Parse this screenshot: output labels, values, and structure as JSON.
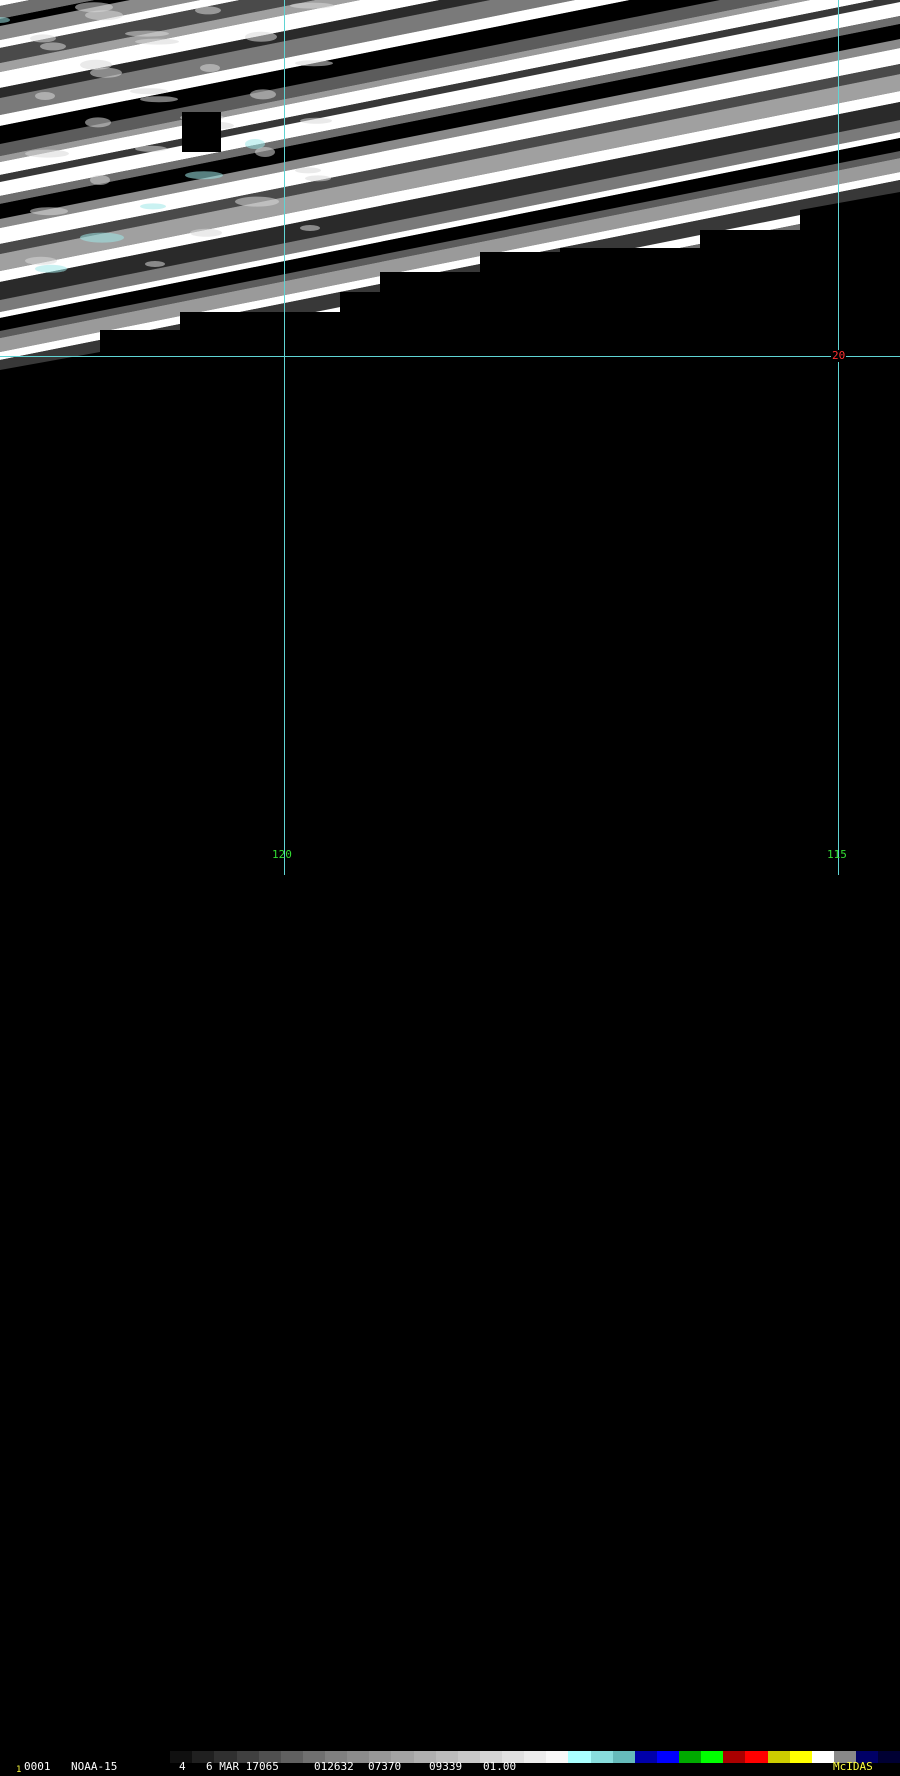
{
  "image_panel": {
    "description_icon": "satellite-imagery"
  },
  "grid": {
    "line_color": "#5fd4d4",
    "lon_label_color": "#33dd33",
    "lat_label_color": "#ff3030",
    "lon_labels": [
      "120",
      "115"
    ],
    "lat_labels": [
      "20"
    ]
  },
  "status": {
    "frame_index": "1",
    "frame_number": "0001",
    "satellite": "NOAA-15",
    "band": "4",
    "date": "6 MAR 17065",
    "time": "012632",
    "line": "07370",
    "element": "09339",
    "magnification": "01.00",
    "vendor": "McIDAS",
    "text_color": "#ffffff",
    "vendor_color": "#ffff40",
    "frame_index_color": "#ffff40"
  },
  "colorbar_colors": [
    "#000000",
    "#101010",
    "#202020",
    "#303030",
    "#404040",
    "#505050",
    "#606060",
    "#707070",
    "#808080",
    "#8c8c8c",
    "#989898",
    "#a4a4a4",
    "#b0b0b0",
    "#bcbcbc",
    "#c8c8c8",
    "#d4d4d4",
    "#e0e0e0",
    "#ececec",
    "#f8f8f8",
    "#aaffff",
    "#88dddd",
    "#66bbbb",
    "#0000aa",
    "#0000ff",
    "#00aa00",
    "#00ff00",
    "#aa0000",
    "#ff0000",
    "#cccc00",
    "#ffff00",
    "#ffffff",
    "#888888",
    "#000066",
    "#000033"
  ]
}
